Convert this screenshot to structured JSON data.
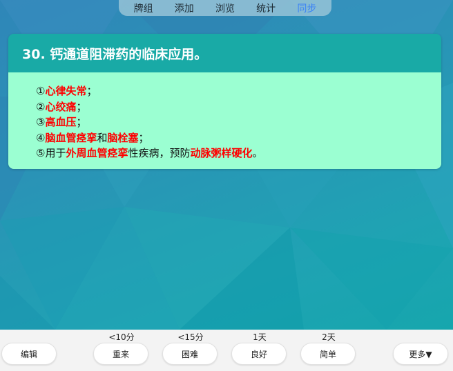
{
  "nav": {
    "items": [
      {
        "label": "牌组"
      },
      {
        "label": "添加"
      },
      {
        "label": "浏览"
      },
      {
        "label": "统计"
      },
      {
        "label": "同步"
      }
    ]
  },
  "card": {
    "title": "30. 钙通道阻滞药的临床应用。",
    "lines": [
      [
        {
          "t": "①"
        },
        {
          "t": "心律失常",
          "red": true
        },
        {
          "t": "；"
        }
      ],
      [
        {
          "t": "②"
        },
        {
          "t": "心绞痛",
          "red": true
        },
        {
          "t": "；"
        }
      ],
      [
        {
          "t": "③"
        },
        {
          "t": "高血压",
          "red": true
        },
        {
          "t": "；"
        }
      ],
      [
        {
          "t": "④"
        },
        {
          "t": "脑血管痉挛",
          "red": true
        },
        {
          "t": "和"
        },
        {
          "t": "脑栓塞",
          "red": true
        },
        {
          "t": "；"
        }
      ],
      [
        {
          "t": "⑤用于"
        },
        {
          "t": "外周血管痉挛",
          "red": true
        },
        {
          "t": "性疾病，预防"
        },
        {
          "t": "动脉粥样硬化",
          "red": true
        },
        {
          "t": "。"
        }
      ]
    ]
  },
  "footer": {
    "edit_label": "编辑",
    "again": {
      "time": "<10分",
      "label": "重来"
    },
    "hard": {
      "time": "<15分",
      "label": "困难"
    },
    "good": {
      "time": "1天",
      "label": "良好"
    },
    "easy": {
      "time": "2天",
      "label": "简单"
    },
    "more_label": "更多▼"
  }
}
